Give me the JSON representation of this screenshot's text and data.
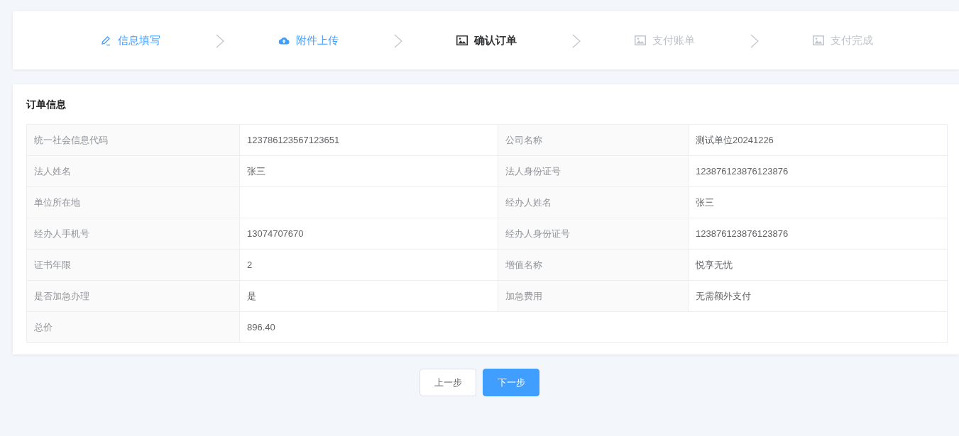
{
  "steps": [
    {
      "label": "信息填写",
      "completed": true,
      "selected": false,
      "kind": "edit"
    },
    {
      "label": "附件上传",
      "completed": true,
      "selected": false,
      "kind": "upload"
    },
    {
      "label": "确认订单",
      "completed": false,
      "selected": true,
      "kind": "image"
    },
    {
      "label": "支付账单",
      "completed": false,
      "selected": false,
      "kind": "image"
    },
    {
      "label": "支付完成",
      "completed": false,
      "selected": false,
      "kind": "image"
    }
  ],
  "order": {
    "title": "订单信息",
    "rows": [
      [
        {
          "label": "统一社会信息代码",
          "value": "123786123567123651"
        },
        {
          "label": "公司名称",
          "value": "测试单位20241226"
        }
      ],
      [
        {
          "label": "法人姓名",
          "value": "张三"
        },
        {
          "label": "法人身份证号",
          "value": "123876123876123876"
        }
      ],
      [
        {
          "label": "单位所在地"
        },
        {
          "label": "经办人姓名",
          "value": "张三"
        }
      ],
      [
        {
          "label": "经办人手机号",
          "value": "13074707670"
        },
        {
          "label": "经办人身份证号",
          "value": "123876123876123876"
        }
      ],
      [
        {
          "label": "证书年限",
          "value": "2"
        },
        {
          "label": "增值名称",
          "value": "悦享无忧"
        }
      ],
      [
        {
          "label": "是否加急办理",
          "value": "是"
        },
        {
          "label": "加急费用",
          "value": "无需额外支付"
        }
      ],
      [
        {
          "label": "总价",
          "value": "896.40"
        }
      ]
    ]
  },
  "buttons": [
    {
      "label": "上一步",
      "kind": "secondary"
    },
    {
      "label": "下一步",
      "kind": "primary"
    }
  ]
}
